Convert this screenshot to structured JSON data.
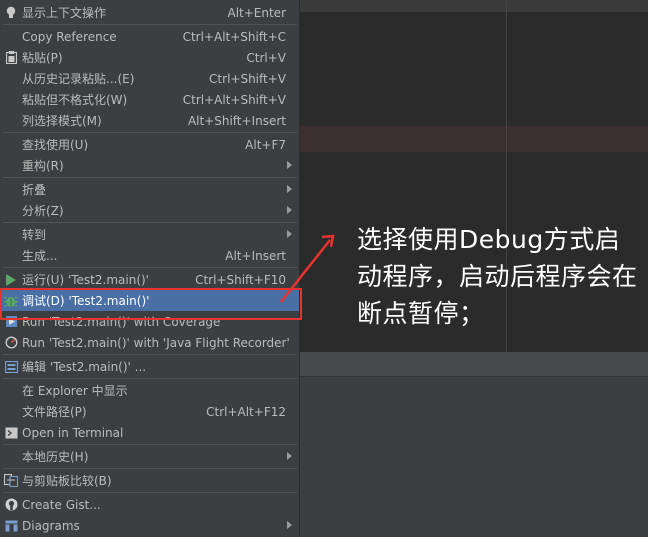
{
  "menu": {
    "items": [
      {
        "label": "显示上下文操作",
        "shortcut": "Alt+Enter",
        "icon": "bulb-icon"
      },
      {
        "label": "Copy Reference",
        "shortcut": "Ctrl+Alt+Shift+C"
      },
      {
        "label": "粘贴(P)",
        "shortcut": "Ctrl+V",
        "icon": "clipboard-icon"
      },
      {
        "label": "从历史记录粘贴...(E)",
        "shortcut": "Ctrl+Shift+V"
      },
      {
        "label": "粘贴但不格式化(W)",
        "shortcut": "Ctrl+Alt+Shift+V"
      },
      {
        "label": "列选择模式(M)",
        "shortcut": "Alt+Shift+Insert"
      },
      {
        "label": "查找使用(U)",
        "shortcut": "Alt+F7"
      },
      {
        "label": "重构(R)",
        "shortcut": "",
        "submenu": true
      },
      {
        "label": "折叠",
        "shortcut": "",
        "submenu": true
      },
      {
        "label": "分析(Z)",
        "shortcut": "",
        "submenu": true
      },
      {
        "label": "转到",
        "shortcut": "",
        "submenu": true
      },
      {
        "label": "生成...",
        "shortcut": "Alt+Insert"
      },
      {
        "label": "运行(U) 'Test2.main()'",
        "shortcut": "Ctrl+Shift+F10",
        "icon": "run-icon"
      },
      {
        "label": "调试(D) 'Test2.main()'",
        "shortcut": "",
        "icon": "debug-icon",
        "selected": true
      },
      {
        "label": "Run 'Test2.main()' with Coverage",
        "shortcut": "",
        "icon": "coverage-icon"
      },
      {
        "label": "Run 'Test2.main()' with 'Java Flight Recorder'",
        "shortcut": "",
        "icon": "profiler-icon"
      },
      {
        "label": "编辑 'Test2.main()' ...",
        "shortcut": "",
        "icon": "edit-config-icon"
      },
      {
        "label": "在 Explorer 中显示",
        "shortcut": ""
      },
      {
        "label": "文件路径(P)",
        "shortcut": "Ctrl+Alt+F12"
      },
      {
        "label": "Open in Terminal",
        "shortcut": "",
        "icon": "terminal-icon"
      },
      {
        "label": "本地历史(H)",
        "shortcut": "",
        "submenu": true
      },
      {
        "label": "与剪贴板比较(B)",
        "shortcut": "",
        "icon": "compare-icon"
      },
      {
        "label": "Create Gist...",
        "shortcut": "",
        "icon": "github-icon"
      },
      {
        "label": "Diagrams",
        "shortcut": "",
        "submenu": true,
        "icon": "diagram-icon"
      }
    ]
  },
  "annotation": {
    "text": "选择使用Debug方式启动程序，启动后程序会在断点暂停；",
    "color": "#e8322e"
  },
  "colors": {
    "menu_bg": "#3c3f41",
    "selected_bg": "#4a6fa5",
    "text": "#bbbbbb",
    "editor_bg": "#2b2b2b"
  }
}
